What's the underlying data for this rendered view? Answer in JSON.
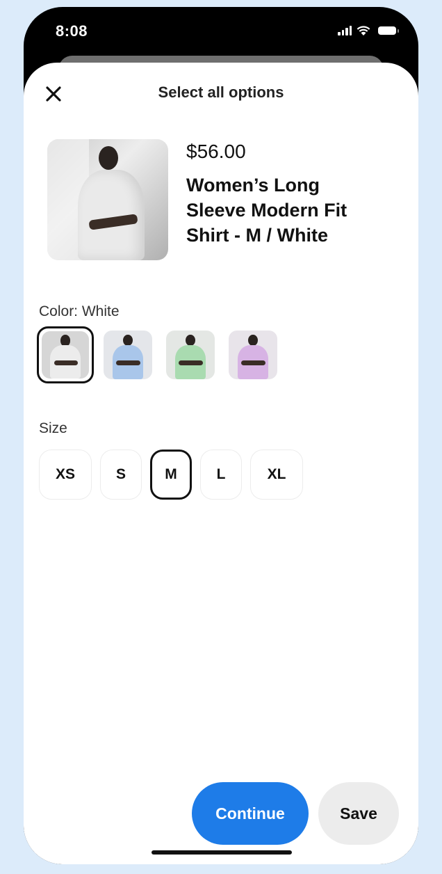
{
  "status_bar": {
    "time": "8:08"
  },
  "header": {
    "title": "Select all options"
  },
  "product": {
    "price": "$56.00",
    "name": "Women’s Long Sleeve Modern Fit Shirt - M / White"
  },
  "color": {
    "label": "Color: White",
    "swatches": [
      {
        "name": "White",
        "shirt": "#ececec",
        "bg": "#d6d6d6",
        "selected": true
      },
      {
        "name": "Blue",
        "shirt": "#a9c6ea",
        "bg": "#e4e6ea",
        "selected": false
      },
      {
        "name": "Green",
        "shirt": "#a9dbb0",
        "bg": "#e4e7e4",
        "selected": false
      },
      {
        "name": "Purple",
        "shirt": "#d7b3e4",
        "bg": "#e8e4ea",
        "selected": false
      }
    ]
  },
  "size": {
    "label": "Size",
    "options": [
      "XS",
      "S",
      "M",
      "L",
      "XL"
    ],
    "selected": "M"
  },
  "footer": {
    "continue_label": "Continue",
    "save_label": "Save"
  },
  "colors": {
    "accent": "#1e7ce8",
    "background": "#dcebfa"
  }
}
